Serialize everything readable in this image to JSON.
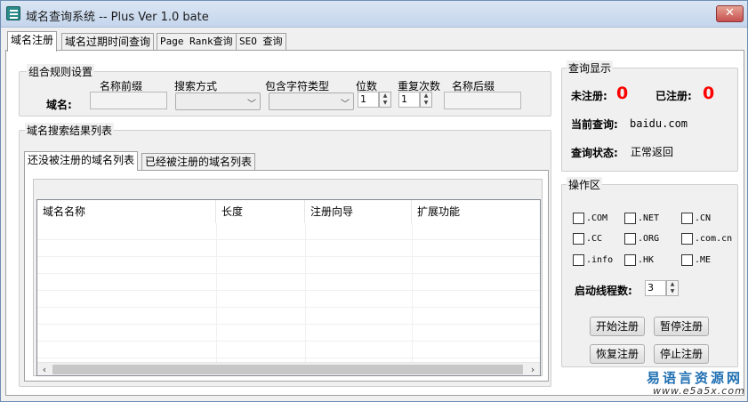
{
  "window": {
    "title": "域名查询系统 -- Plus Ver 1.0 bate",
    "close_glyph": "✕"
  },
  "main_tabs": [
    {
      "label": "域名注册",
      "active": true
    },
    {
      "label": "域名过期时间查询",
      "active": false
    },
    {
      "label": "Page Rank查询",
      "active": false
    },
    {
      "label": "SEO 查询",
      "active": false
    }
  ],
  "rules_group": {
    "title": "组合规则设置",
    "domain_label": "域名:",
    "prefix_label": "名称前缀",
    "search_mode_label": "搜索方式",
    "char_type_label": "包含字符类型",
    "digits_label": "位数",
    "digits_value": "1",
    "repeat_label": "重复次数",
    "repeat_value": "1",
    "suffix_label": "名称后缀"
  },
  "results_group": {
    "title": "域名搜索结果列表",
    "tabs": [
      {
        "label": "还没被注册的域名列表",
        "active": true
      },
      {
        "label": "已经被注册的域名列表",
        "active": false
      }
    ],
    "columns": [
      "域名名称",
      "长度",
      "注册向导",
      "扩展功能"
    ]
  },
  "query_display": {
    "title": "查询显示",
    "unregistered_label": "未注册:",
    "unregistered_count": "0",
    "registered_label": "已注册:",
    "registered_count": "0",
    "current_query_label": "当前查询:",
    "current_query_value": "baidu.com",
    "status_label": "查询状态:",
    "status_value": "正常返回"
  },
  "operations": {
    "title": "操作区",
    "extensions": [
      ".COM",
      ".NET",
      ".CN",
      ".CC",
      ".ORG",
      ".com.cn",
      ".info",
      ".HK",
      ".ME"
    ],
    "threads_label": "启动线程数:",
    "threads_value": "3",
    "buttons": {
      "start": "开始注册",
      "pause": "暂停注册",
      "resume": "恢复注册",
      "stop": "停止注册"
    }
  },
  "watermark": {
    "site_name": "易语言资源网",
    "url": "www.e5a5x.com"
  },
  "colors": {
    "count_red": "#ff0000",
    "title_bar": "#c4d5ec",
    "watermark_blue": "#1f6fb2"
  }
}
